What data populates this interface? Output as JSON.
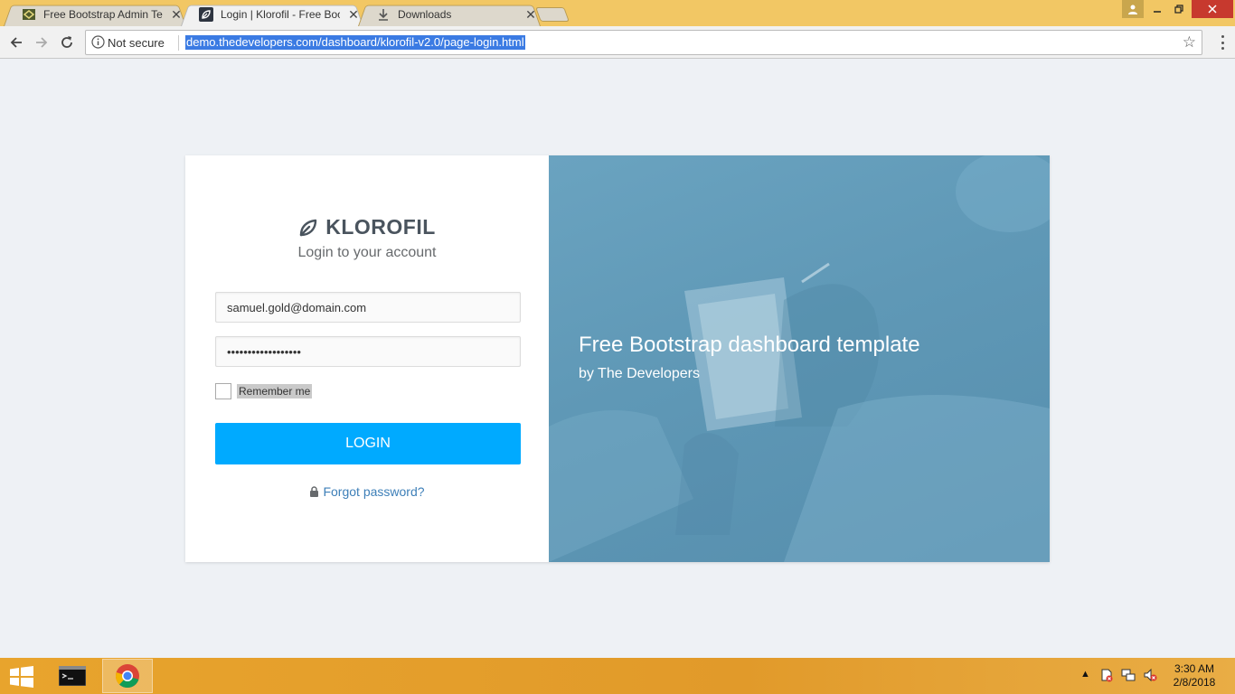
{
  "browser": {
    "tabs": [
      {
        "title": "Free Bootstrap Admin Te",
        "state": "inactive"
      },
      {
        "title": "Login | Klorofil - Free Boo",
        "state": "active"
      },
      {
        "title": "Downloads",
        "state": "inactive"
      }
    ],
    "address": {
      "security_label": "Not secure",
      "url": "demo.thedevelopers.com/dashboard/klorofil-v2.0/page-login.html"
    }
  },
  "login": {
    "brand": "KLOROFIL",
    "subtitle": "Login to your account",
    "email_value": "samuel.gold@domain.com",
    "password_value": "••••••••••••••••••",
    "remember_label": "Remember me",
    "login_button": "LOGIN",
    "forgot_label": "Forgot password?"
  },
  "hero": {
    "title": "Free Bootstrap dashboard template",
    "subtitle": "by The Developers"
  },
  "taskbar": {
    "time": "3:30 AM",
    "date": "2/8/2018"
  },
  "colors": {
    "accent": "#00aaff",
    "hero_bg": "#5f98b6",
    "taskbar": "#e19a2a",
    "tabbar": "#f2c764"
  }
}
